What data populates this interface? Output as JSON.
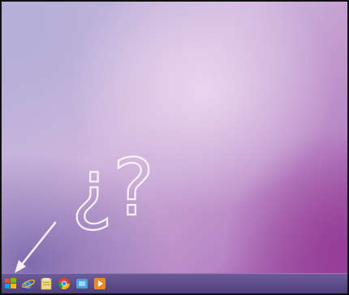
{
  "desktop": {
    "overlay_text": "¿?"
  },
  "taskbar": {
    "items": [
      {
        "name": "start-button",
        "icon": "windows-logo-icon"
      },
      {
        "name": "internet-explorer",
        "icon": "internet-explorer-icon"
      },
      {
        "name": "file-explorer",
        "icon": "folder-icon"
      },
      {
        "name": "chrome",
        "icon": "chrome-icon"
      },
      {
        "name": "windows-media-center",
        "icon": "media-center-icon"
      },
      {
        "name": "media-player",
        "icon": "media-player-icon"
      }
    ]
  },
  "colors": {
    "taskbar": "#5a4a88",
    "wallpaper_light": "#e3d2ea",
    "wallpaper_dark": "#8f3f98",
    "annotation": "#f6f2f8"
  }
}
